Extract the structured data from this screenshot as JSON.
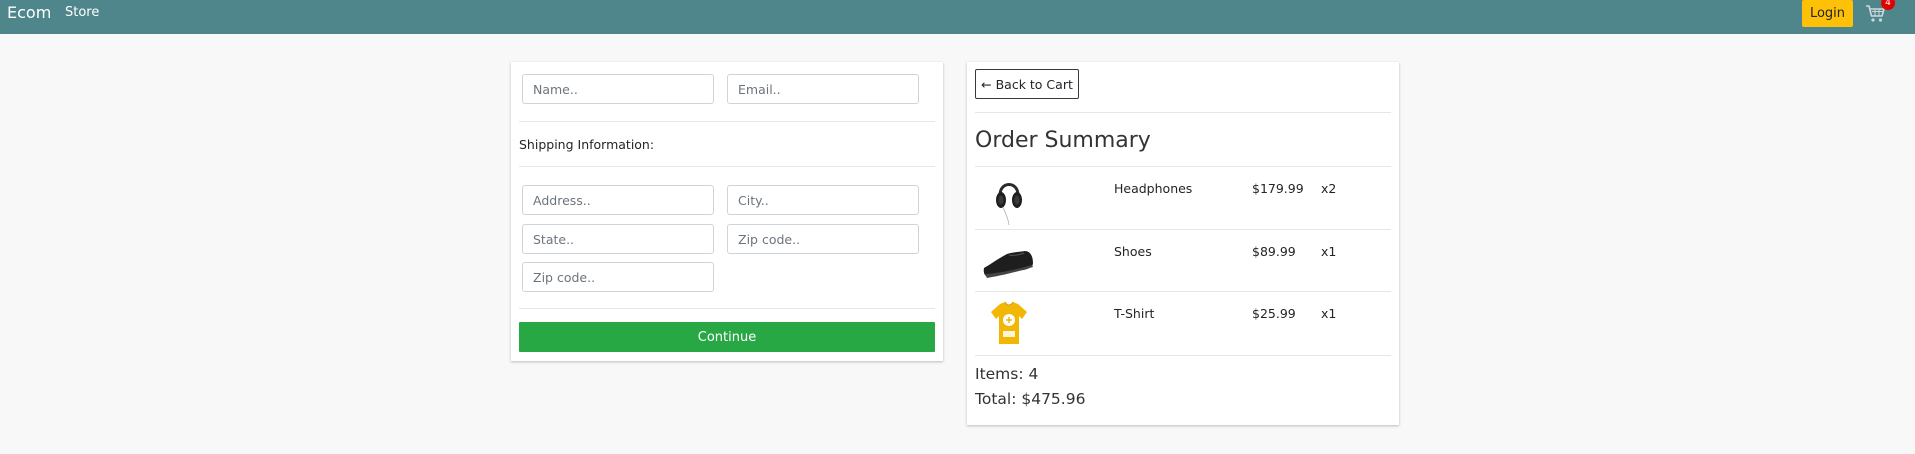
{
  "navbar": {
    "brand": "Ecom",
    "links": [
      "Store"
    ],
    "login_label": "Login",
    "cart_count": "4",
    "cart_icon": "cart-icon"
  },
  "form": {
    "name_placeholder": "Name..",
    "email_placeholder": "Email..",
    "shipping_label": "Shipping Information:",
    "address_placeholder": "Address..",
    "city_placeholder": "City..",
    "state_placeholder": "State..",
    "zip_placeholder": "Zip code..",
    "zip2_placeholder": "Zip code..",
    "continue_label": "Continue"
  },
  "summary": {
    "back_label": "← Back to Cart",
    "title": "Order Summary",
    "items": [
      {
        "name": "Headphones",
        "price": "$179.99",
        "qty": "x2",
        "image": "headphones-image"
      },
      {
        "name": "Shoes",
        "price": "$89.99",
        "qty": "x1",
        "image": "shoe-image"
      },
      {
        "name": "T-Shirt",
        "price": "$25.99",
        "qty": "x1",
        "image": "tshirt-image"
      }
    ],
    "items_text": "Items: 4",
    "total_text": "Total: $475.96"
  },
  "colors": {
    "navbar": "#4f868c",
    "login": "#ffc107",
    "continue": "#28a745",
    "badge": "#e00000"
  }
}
